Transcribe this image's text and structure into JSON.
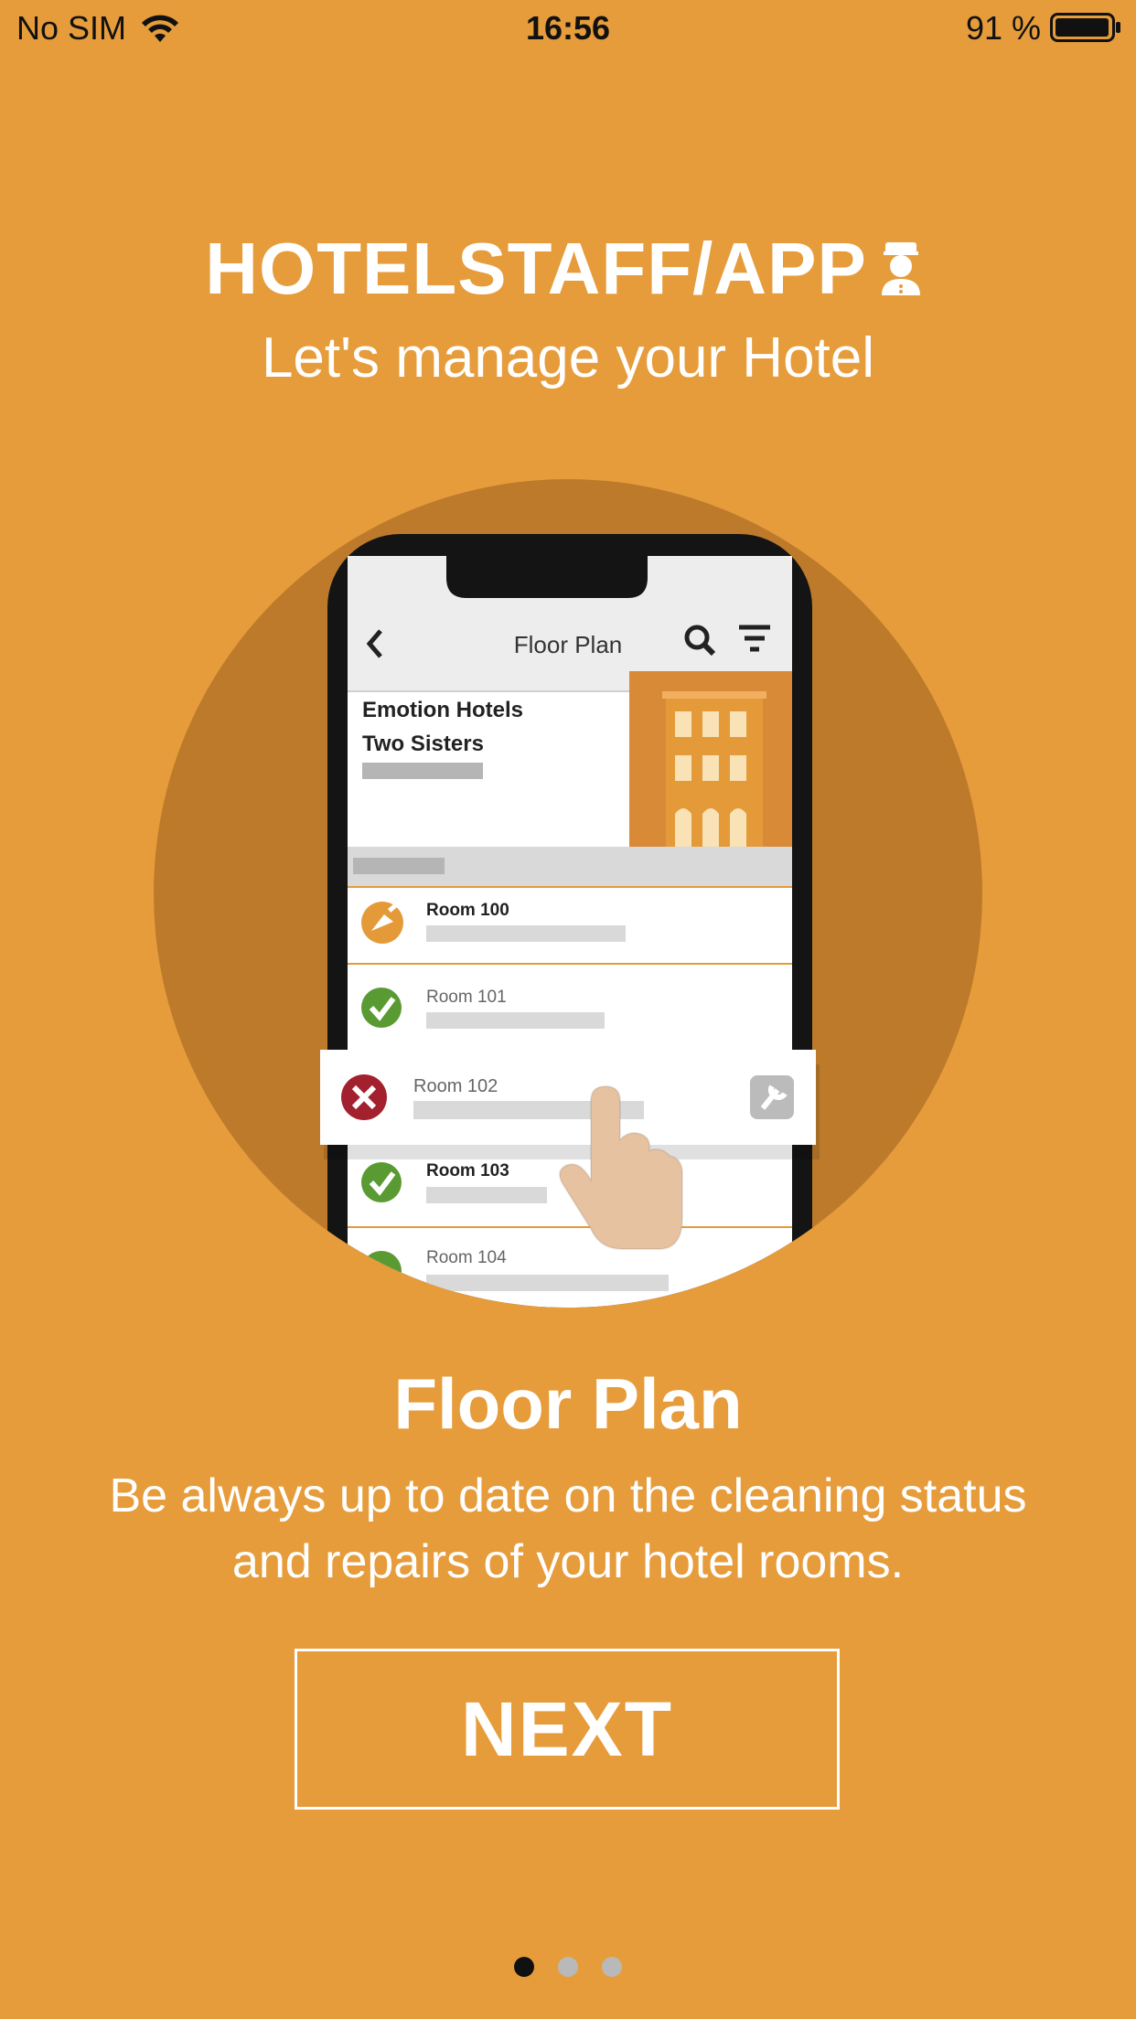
{
  "status_bar": {
    "carrier": "No SIM",
    "time": "16:56",
    "battery": "91 %",
    "wifi_icon": "wifi-icon",
    "battery_icon": "battery-icon"
  },
  "brand": {
    "name": "HOTELSTAFF/APP",
    "logo_icon": "bellboy-icon"
  },
  "subtitle": "Let's manage your Hotel",
  "illustration": {
    "header_title": "Floor Plan",
    "hotel_name_line1": "Emotion Hotels",
    "hotel_name_line2": "Two Sisters",
    "rooms": [
      {
        "name": "Room 100",
        "status": "cleaning"
      },
      {
        "name": "Room 101",
        "status": "clean"
      },
      {
        "name": "Room 102",
        "status": "dirty"
      },
      {
        "name": "Room 103",
        "status": "clean"
      },
      {
        "name": "Room 104",
        "status": "clean"
      }
    ],
    "colors": {
      "circle": "#BD7A2B",
      "accent": "#E59A3A",
      "green": "#5A9A32",
      "red": "#A3212E"
    }
  },
  "feature": {
    "title": "Floor Plan",
    "description_line1": "Be always up to date on the cleaning status",
    "description_line2": "and repairs of your hotel rooms."
  },
  "next_button": "NEXT",
  "pagination": {
    "total": 3,
    "current": 1
  },
  "colors": {
    "background": "#E69C3B",
    "text": "#FFFFFF"
  }
}
